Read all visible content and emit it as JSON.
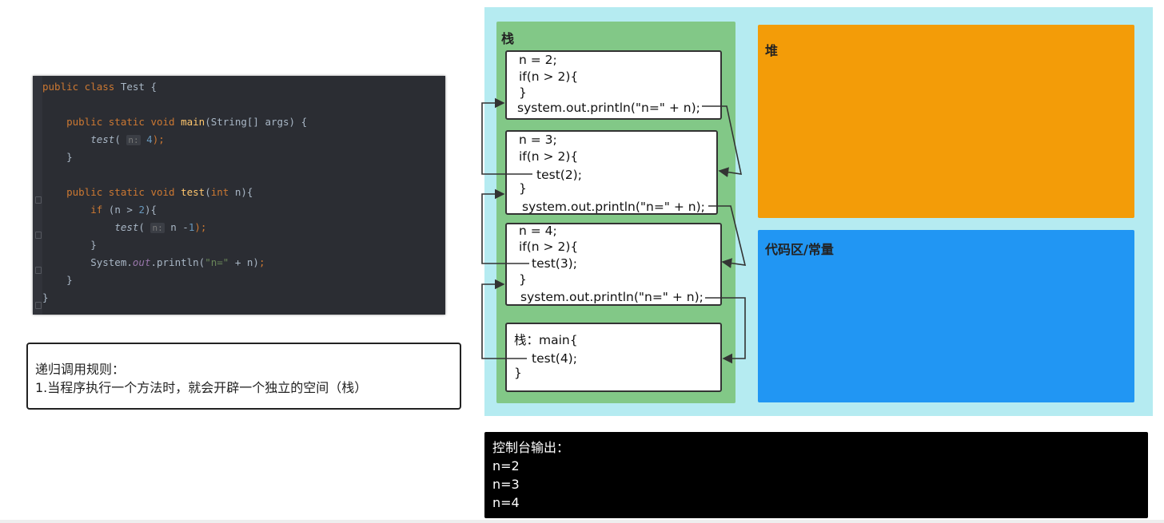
{
  "code_editor": {
    "lines": [
      [
        {
          "t": "public class ",
          "c": "kw"
        },
        {
          "t": "Test {",
          "c": ""
        }
      ],
      [],
      [
        {
          "t": "    public static void ",
          "c": "kw"
        },
        {
          "t": "main",
          "c": "fn"
        },
        {
          "t": "(String[] args) {",
          "c": ""
        }
      ],
      [
        {
          "t": "        ",
          "c": ""
        },
        {
          "t": "test",
          "c": "it"
        },
        {
          "t": "( ",
          "c": ""
        },
        {
          "t": "n:",
          "c": "hint"
        },
        {
          "t": " ",
          "c": ""
        },
        {
          "t": "4",
          "c": "num"
        },
        {
          "t": ");",
          "c": "kw"
        }
      ],
      [
        {
          "t": "    }",
          "c": ""
        }
      ],
      [],
      [
        {
          "t": "    public static void ",
          "c": "kw"
        },
        {
          "t": "test",
          "c": "fn"
        },
        {
          "t": "(",
          "c": ""
        },
        {
          "t": "int ",
          "c": "kw"
        },
        {
          "t": "n){",
          "c": ""
        }
      ],
      [
        {
          "t": "        ",
          "c": ""
        },
        {
          "t": "if ",
          "c": "kw"
        },
        {
          "t": "(n > ",
          "c": ""
        },
        {
          "t": "2",
          "c": "num"
        },
        {
          "t": "){",
          "c": ""
        }
      ],
      [
        {
          "t": "            ",
          "c": ""
        },
        {
          "t": "test",
          "c": "it"
        },
        {
          "t": "( ",
          "c": ""
        },
        {
          "t": "n:",
          "c": "hint"
        },
        {
          "t": " n -",
          "c": ""
        },
        {
          "t": "1",
          "c": "num"
        },
        {
          "t": ");",
          "c": "kw"
        }
      ],
      [
        {
          "t": "        }",
          "c": ""
        }
      ],
      [
        {
          "t": "        System.",
          "c": ""
        },
        {
          "t": "out",
          "c": "it kw2"
        },
        {
          "t": ".println(",
          "c": ""
        },
        {
          "t": "\"n=\"",
          "c": "str"
        },
        {
          "t": " + n)",
          "c": ""
        },
        {
          "t": ";",
          "c": "kw"
        }
      ],
      [
        {
          "t": "    }",
          "c": ""
        }
      ],
      [
        {
          "t": "}",
          "c": ""
        }
      ]
    ]
  },
  "rules": {
    "title": "递归调用规则：",
    "item1": "1.当程序执行一个方法时，就会开辟一个独立的空间（栈）"
  },
  "memory": {
    "stack_label": "栈",
    "heap_label": "堆",
    "code_area_label": "代码区/常量",
    "frames": {
      "n2": {
        "l1": "n = 2;",
        "l2": "if(n > 2){",
        "l3": "}",
        "l4": "system.out.println(\"n=\" + n);"
      },
      "n3": {
        "l1": "n = 3;",
        "l2": "if(n > 2){",
        "l3": "test(2);",
        "l4": "}",
        "l5": "system.out.println(\"n=\" + n);"
      },
      "n4": {
        "l1": "n = 4;",
        "l2": "if(n > 2){",
        "l3": "test(3);",
        "l4": "}",
        "l5": "system.out.println(\"n=\" + n);"
      },
      "main": {
        "l1": "栈：main{",
        "l2": "test(4);",
        "l3": "}"
      }
    }
  },
  "console": {
    "title": "控制台输出：",
    "lines": [
      "n=2",
      "n=3",
      "n=4"
    ]
  },
  "colors": {
    "memory_bg": "#b5ebf1",
    "stack_bg": "#82c887",
    "heap_bg": "#f39c08",
    "code_area_bg": "#2196f3",
    "console_bg": "#000000",
    "editor_bg": "#2b2d33"
  }
}
